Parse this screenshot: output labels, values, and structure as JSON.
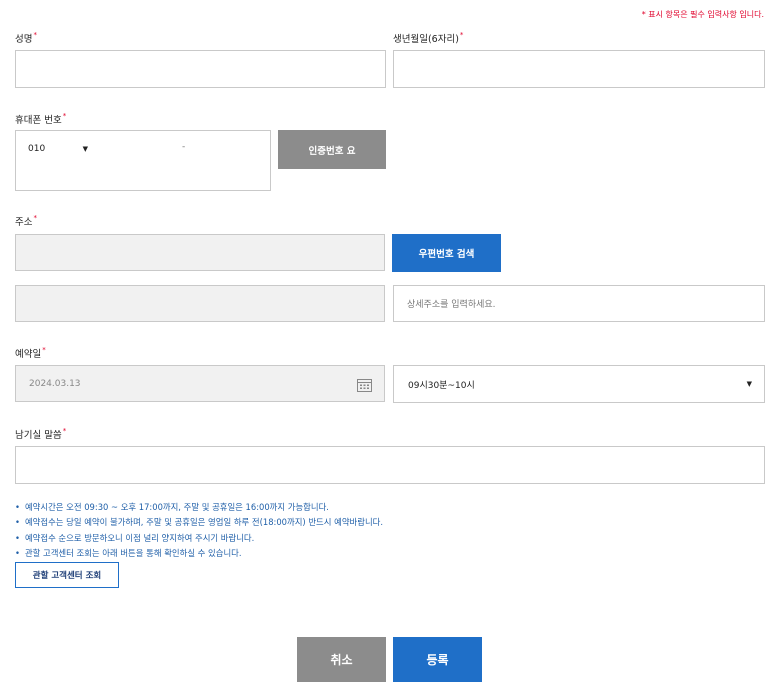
{
  "required_note": "* 표시 항목은 필수 입력사항 입니다.",
  "required_mark": "*",
  "fields": {
    "name": {
      "label": "성명",
      "value": ""
    },
    "birth": {
      "label": "생년월일(6자리)",
      "value": ""
    },
    "phone": {
      "label": "휴대폰 번호",
      "prefix": "010",
      "separator": "-",
      "verify_button": "인증번호 요"
    },
    "address": {
      "label": "주소",
      "postcode_button": "우편번호 검색",
      "detail_placeholder": "상세주소를 입력하세요."
    },
    "reservation": {
      "label": "예약일",
      "date": "2024.03.13",
      "time": "09시30분~10시"
    },
    "message": {
      "label": "남기실 말씀",
      "value": ""
    }
  },
  "notes": [
    "예약시간은 오전 09:30 ~ 오후 17:00까지, 주말 및 공휴일은 16:00까지 가능합니다.",
    "예약접수는 당일 예약이 불가하며, 주말 및 공휴일은 영업일 하루 전(18:00까지) 반드시 예약바랍니다.",
    "예약접수 순으로 방문하오니 이점 널리 양지하여 주시기 바랍니다.",
    "관할 고객센터 조회는 아래 버튼을 통해 확인하실 수 있습니다."
  ],
  "center_button": "관할 고객센터 조회",
  "actions": {
    "cancel": "취소",
    "submit": "등록"
  },
  "colors": {
    "accent": "#1f6fc8",
    "gray_button": "#8c8c8c",
    "required": "#e0002a"
  }
}
